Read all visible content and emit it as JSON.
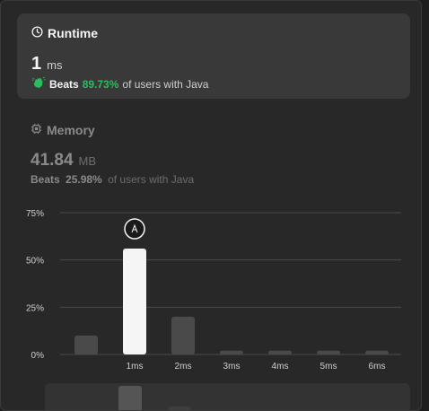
{
  "runtime": {
    "title": "Runtime",
    "value": "1",
    "unit": "ms",
    "beats_label": "Beats",
    "beats_pct": "89.73%",
    "beats_suffix": "of users with Java",
    "accent_color": "#2cbb5d"
  },
  "memory": {
    "title": "Memory",
    "value": "41.84",
    "unit": "MB",
    "beats_label": "Beats",
    "beats_pct": "25.98%",
    "beats_suffix": "of users with Java"
  },
  "chart_data": {
    "type": "bar",
    "categories": [
      "",
      "1ms",
      "2ms",
      "3ms",
      "4ms",
      "5ms",
      "6ms"
    ],
    "values": [
      10,
      56,
      20,
      2,
      2,
      2,
      2
    ],
    "highlight_index": 1,
    "y_ticks": [
      "75%",
      "50%",
      "25%",
      "0%"
    ],
    "ylim": [
      0,
      75
    ],
    "grid": true,
    "highlight_color": "#f5f5f5",
    "bar_color": "#4a4a4a"
  },
  "icons": {
    "runtime": "clock-icon",
    "beats": "clap-icon",
    "memory": "chip-icon",
    "marker": "avatar-icon"
  }
}
